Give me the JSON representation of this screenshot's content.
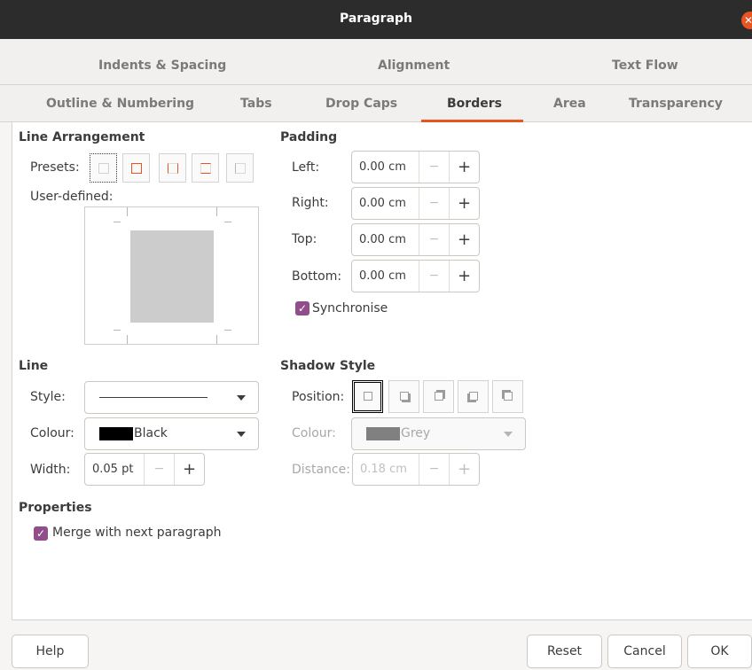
{
  "window": {
    "title": "Paragraph",
    "close_glyph": "✕"
  },
  "tabs_row1": [
    "Indents & Spacing",
    "Alignment",
    "Text Flow"
  ],
  "tabs_row2": [
    "Outline & Numbering",
    "Tabs",
    "Drop Caps",
    "Borders",
    "Area",
    "Transparency"
  ],
  "active_tab": "Borders",
  "line_arrangement": {
    "heading": "Line Arrangement",
    "presets_label": "Presets:",
    "presets": [
      "no-borders-icon",
      "all-borders-icon",
      "left-right-borders-icon",
      "top-bottom-borders-icon",
      "left-border-icon"
    ],
    "user_defined_label": "User-defined:"
  },
  "padding": {
    "heading": "Padding",
    "left_label": "Left:",
    "left_value": "0.00 cm",
    "right_label": "Right:",
    "right_value": "0.00 cm",
    "top_label": "Top:",
    "top_value": "0.00 cm",
    "bottom_label": "Bottom:",
    "bottom_value": "0.00 cm",
    "synchronise_label": "Synchronise",
    "synchronise_checked": true
  },
  "line": {
    "heading": "Line",
    "style_label": "Style:",
    "colour_label": "Colour:",
    "colour_value": "Black",
    "colour_swatch": "#000000",
    "width_label": "Width:",
    "width_value": "0.05 pt"
  },
  "shadow": {
    "heading": "Shadow Style",
    "position_label": "Position:",
    "positions": [
      "no-shadow-icon",
      "shadow-bottom-right-icon",
      "shadow-top-right-icon",
      "shadow-bottom-left-icon",
      "shadow-top-left-icon"
    ],
    "colour_label": "Colour:",
    "colour_value": "Grey",
    "colour_swatch": "#808080",
    "distance_label": "Distance:",
    "distance_value": "0.18 cm"
  },
  "properties": {
    "heading": "Properties",
    "merge_label": "Merge with next paragraph",
    "merge_checked": true
  },
  "spin_glyphs": {
    "minus": "−",
    "plus": "+"
  },
  "buttons": {
    "help": "Help",
    "reset": "Reset",
    "cancel": "Cancel",
    "ok": "OK"
  },
  "colors": {
    "accent": "#e95420",
    "checkbox": "#924d8b",
    "titlebar": "#2c2c2c"
  }
}
